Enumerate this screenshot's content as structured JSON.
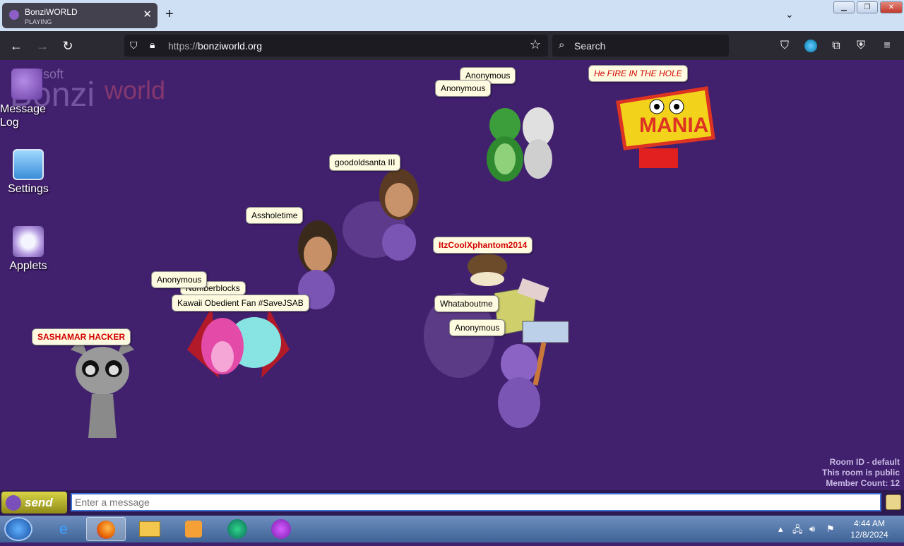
{
  "browser": {
    "tab_title": "BonziWORLD",
    "tab_status": "PLAYING",
    "url_scheme": "https://",
    "url_host": "bonziworld.org",
    "search_placeholder": "Search"
  },
  "page": {
    "logo_small": "bonzisoft",
    "logo_main": "Bonzi",
    "logo_accent": "world",
    "desktop_icons": [
      {
        "label": "Message Log",
        "icon": "message-log-icon"
      },
      {
        "label": "Settings",
        "icon": "settings-icon"
      },
      {
        "label": "Applets",
        "icon": "applets-icon"
      }
    ],
    "name_tags": [
      {
        "text": "Anonymous",
        "style": "plain"
      },
      {
        "text": "Anonymous",
        "style": "plain"
      },
      {
        "text": "He FIRE IN THE HOLE",
        "style": "red-italic"
      },
      {
        "text": "goodoldsanta III",
        "style": "plain"
      },
      {
        "text": "Assholetime",
        "style": "plain"
      },
      {
        "text": "ItzCoolXphantom2014",
        "style": "red-bold"
      },
      {
        "text": "Anonymous",
        "style": "plain"
      },
      {
        "text": "Numberblocks",
        "style": "plain"
      },
      {
        "text": "Kawaii Obedient Fan #SaveJSAB",
        "style": "plain"
      },
      {
        "text": "Whataboutme",
        "style": "plain"
      },
      {
        "text": "Anonymous",
        "style": "plain"
      },
      {
        "text": "SASHAMAR HACKER",
        "style": "red-bold"
      }
    ],
    "room_info": {
      "room_id": "Room ID - default",
      "visibility": "This room is public",
      "member_count": "Member Count: 12"
    },
    "chat": {
      "send_label": "send",
      "placeholder": "Enter a message"
    }
  },
  "taskbar": {
    "apps": [
      "Internet Explorer",
      "Firefox",
      "File Explorer",
      "Media Player",
      "Browser",
      "Bonzi App"
    ],
    "time": "4:44 AM",
    "date": "12/8/2024"
  },
  "colors": {
    "page_bg": "#41206e",
    "tag_bg": "#fffbe0",
    "tag_red": "#d30000",
    "send_bg": "#bdb72e"
  }
}
